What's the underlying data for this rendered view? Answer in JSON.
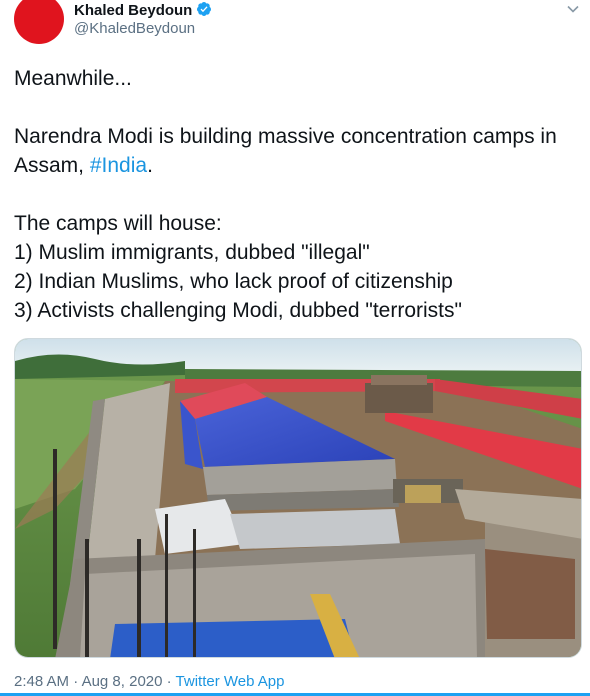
{
  "author": {
    "display_name": "Khaled Beydoun",
    "handle": "@KhaledBeydoun",
    "avatar_color": "#e0141e",
    "verified_icon": "verified-badge-icon",
    "verified_color": "#1da1f2"
  },
  "tweet": {
    "text_before": "Meanwhile...\n\nNarendra Modi is building massive concentration camps in Assam, ",
    "hashtag": "#India",
    "text_after": ".\n\nThe camps will house:\n1) Muslim immigrants, dubbed \"illegal\"\n2) Indian Muslims, who lack proof of citizenship\n3) Activists challenging Modi, dubbed \"terrorists\"",
    "link_color": "#1b95e0"
  },
  "media": {
    "description_icon": "aerial-photo-image"
  },
  "meta": {
    "time": "2:48 AM",
    "separator": " · ",
    "date": "Aug 8, 2020",
    "source": "Twitter Web App"
  },
  "icons": {
    "menu": "chevron-down-icon"
  }
}
